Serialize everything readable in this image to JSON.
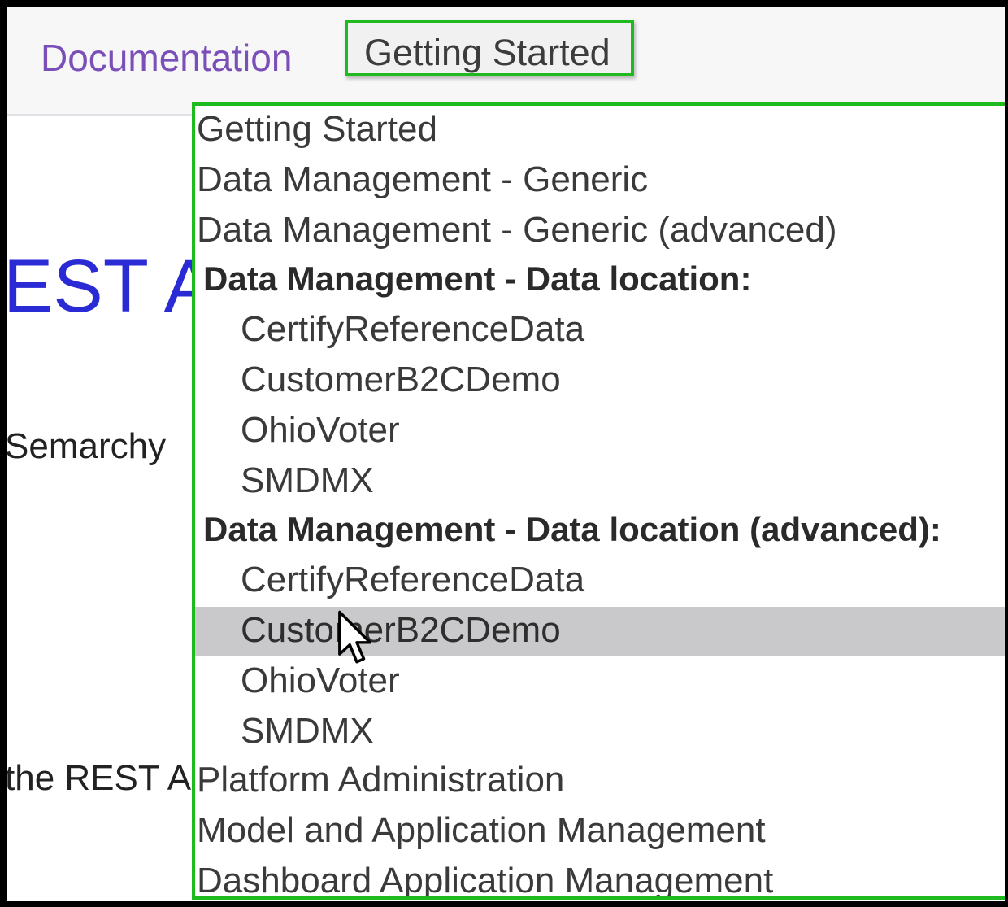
{
  "nav": {
    "documentation": "Documentation"
  },
  "select": {
    "value": "Getting Started"
  },
  "background": {
    "title_fragment": "EST A",
    "semarchy_fragment": "Semarchy",
    "rest_fragment": "the REST A"
  },
  "dropdown": {
    "opt_getting_started": "Getting Started",
    "opt_dm_generic": "Data Management - Generic",
    "opt_dm_generic_adv": "Data Management - Generic (advanced)",
    "group_location": "Data Management - Data location:",
    "loc": {
      "certify": "CertifyReferenceData",
      "customer": "CustomerB2CDemo",
      "ohio": "OhioVoter",
      "smdmx": "SMDMX"
    },
    "group_location_adv": "Data Management - Data location (advanced):",
    "loc_adv": {
      "certify": "CertifyReferenceData",
      "customer": "CustomerB2CDemo",
      "ohio": "OhioVoter",
      "smdmx": "SMDMX"
    },
    "opt_platform_admin": "Platform Administration",
    "opt_model_app": "Model and Application Management",
    "opt_dashboard_app": "Dashboard Application Management"
  },
  "colors": {
    "highlight_border": "#1fba1f",
    "nav_link": "#7b4fb8",
    "title_blue": "#2b2bd6",
    "selected_option_bg": "#c9c9cb"
  },
  "icons": {
    "pointer": "mouse-pointer-icon"
  }
}
